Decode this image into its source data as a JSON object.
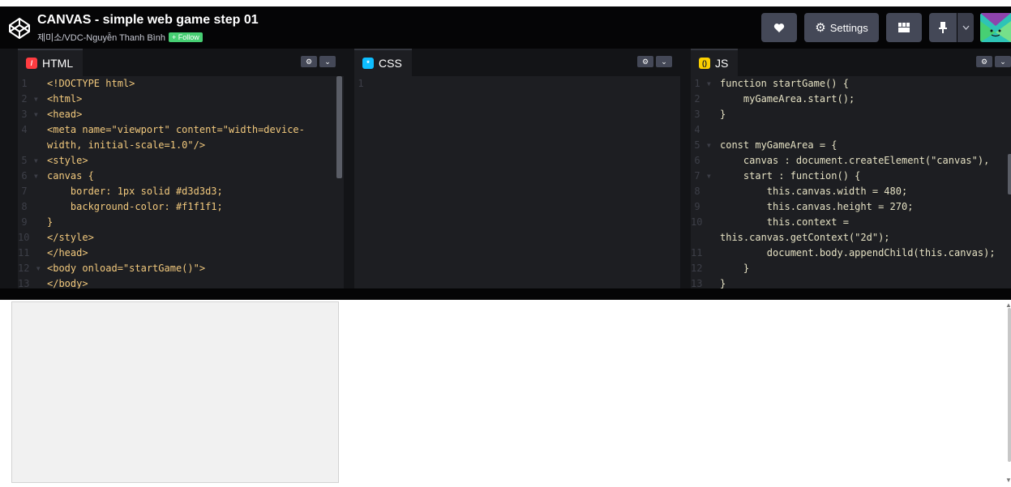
{
  "header": {
    "title": "CANVAS - simple web game step 01",
    "author": "제미소/VDC-Nguyễn Thanh Bình",
    "follow_label": "+ Follow",
    "settings_label": "Settings"
  },
  "editors": {
    "html": {
      "label": "HTML",
      "accent": "#ff3c41",
      "lines": [
        {
          "num": "1",
          "fold": false,
          "text": "<!DOCTYPE html>"
        },
        {
          "num": "2",
          "fold": true,
          "text": "<html>"
        },
        {
          "num": "3",
          "fold": true,
          "text": "<head>"
        },
        {
          "num": "4",
          "fold": false,
          "text": "<meta name=\"viewport\" content=\"width=device-"
        },
        {
          "num": "",
          "fold": false,
          "text": "width, initial-scale=1.0\"/>"
        },
        {
          "num": "5",
          "fold": true,
          "text": "<style>"
        },
        {
          "num": "6",
          "fold": true,
          "text": "canvas {"
        },
        {
          "num": "7",
          "fold": false,
          "text": "    border: 1px solid #d3d3d3;"
        },
        {
          "num": "8",
          "fold": false,
          "text": "    background-color: #f1f1f1;"
        },
        {
          "num": "9",
          "fold": false,
          "text": "}"
        },
        {
          "num": "10",
          "fold": false,
          "text": "</style>"
        },
        {
          "num": "11",
          "fold": false,
          "text": "</head>"
        },
        {
          "num": "12",
          "fold": true,
          "text": "<body onload=\"startGame()\">"
        },
        {
          "num": "13",
          "fold": false,
          "text": "</body>"
        }
      ]
    },
    "css": {
      "label": "CSS",
      "accent": "#0ebeff",
      "lines": [
        {
          "num": "1",
          "fold": false,
          "text": ""
        }
      ]
    },
    "js": {
      "label": "JS",
      "accent": "#fcd000",
      "lines": [
        {
          "num": "1",
          "fold": true,
          "text": "function startGame() {"
        },
        {
          "num": "2",
          "fold": false,
          "text": "    myGameArea.start();"
        },
        {
          "num": "3",
          "fold": false,
          "text": "}"
        },
        {
          "num": "4",
          "fold": false,
          "text": ""
        },
        {
          "num": "5",
          "fold": true,
          "text": "const myGameArea = {"
        },
        {
          "num": "6",
          "fold": false,
          "text": "    canvas : document.createElement(\"canvas\"),"
        },
        {
          "num": "7",
          "fold": true,
          "text": "    start : function() {"
        },
        {
          "num": "8",
          "fold": false,
          "text": "        this.canvas.width = 480;"
        },
        {
          "num": "9",
          "fold": false,
          "text": "        this.canvas.height = 270;"
        },
        {
          "num": "10",
          "fold": false,
          "text": "        this.context ="
        },
        {
          "num": "",
          "fold": false,
          "text": "this.canvas.getContext(\"2d\");"
        },
        {
          "num": "11",
          "fold": false,
          "text": "        document.body.appendChild(this.canvas);"
        },
        {
          "num": "12",
          "fold": false,
          "text": "    }"
        },
        {
          "num": "13",
          "fold": false,
          "text": "}"
        }
      ]
    }
  },
  "icons": {
    "logo": "codepen-logo-icon",
    "heart": "heart-icon",
    "settings": "gear-icon",
    "layout": "layout-icon",
    "pin": "pin-icon",
    "chevron": "chevron-down-icon"
  },
  "colors": {
    "bg_dark": "#050506",
    "editor_bg": "#1d1e22",
    "button_bg": "#444857",
    "follow_green": "#47cf73",
    "canvas_bg": "#f1f1f1",
    "canvas_border": "#d3d3d3"
  }
}
